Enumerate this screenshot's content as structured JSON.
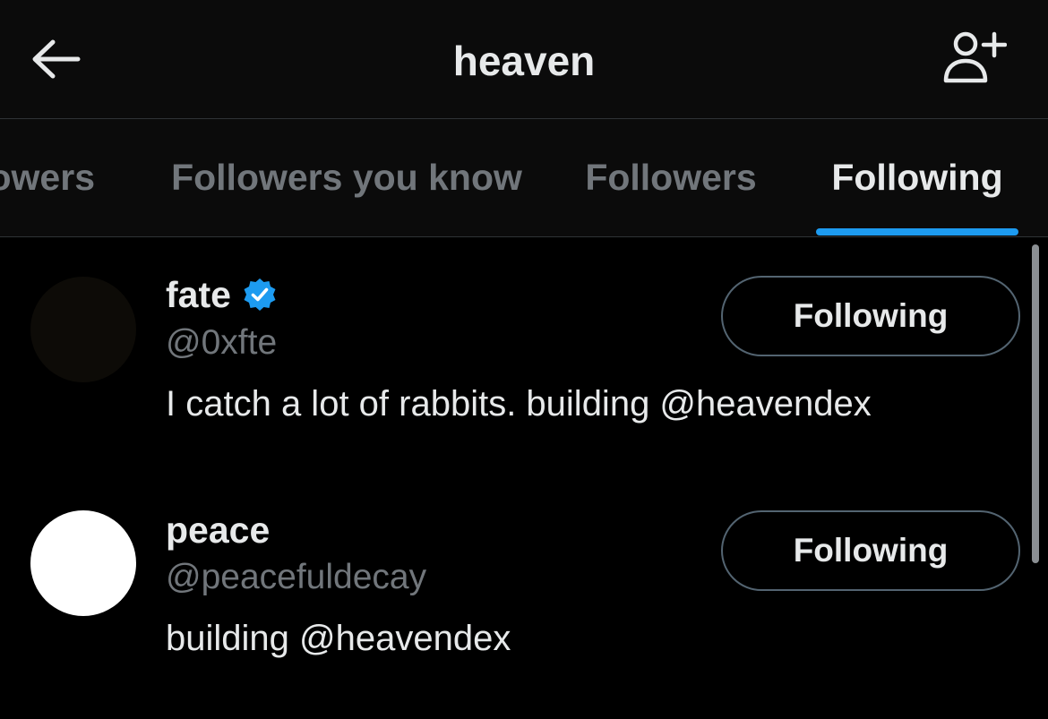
{
  "header": {
    "title": "heaven",
    "back_icon": "arrow-left-icon",
    "add_user_icon": "person-plus-icon"
  },
  "tabs": [
    {
      "label": "Verified Followers",
      "visible_text": "owers",
      "active": false
    },
    {
      "label": "Followers you know",
      "active": false
    },
    {
      "label": "Followers",
      "active": false
    },
    {
      "label": "Following",
      "active": true
    }
  ],
  "colors": {
    "background": "#000000",
    "header_bg": "#0b0b0b",
    "accent": "#1d9bf0",
    "text_primary": "#e7e9ea",
    "text_secondary": "#71767b",
    "divider": "#2f3336"
  },
  "users": [
    {
      "name": "fate",
      "verified": true,
      "handle": "@0xfte",
      "bio": "I catch a lot of rabbits. building @heavendex",
      "button_label": "Following",
      "avatar_color": "#0d0b07"
    },
    {
      "name": "peace",
      "verified": false,
      "handle": "@peacefuldecay",
      "bio": "building @heavendex",
      "button_label": "Following",
      "avatar_color": "#ffffff"
    }
  ]
}
